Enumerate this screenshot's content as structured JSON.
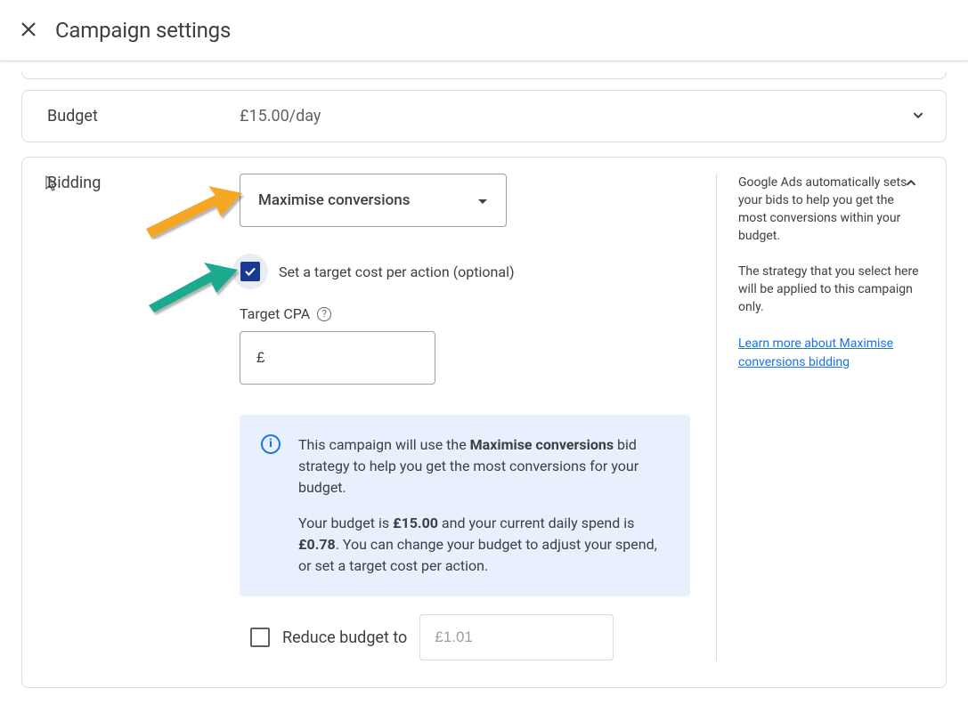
{
  "header": {
    "page_title": "Campaign settings"
  },
  "budget": {
    "label": "Budget",
    "value": "£15.00/day"
  },
  "bidding": {
    "label": "Bidding",
    "dropdown_value": "Maximise conversions",
    "tcpa_checkbox_label": "Set a target cost per action (optional)",
    "tcpa_label": "Target CPA",
    "tcpa_input_value": "£",
    "reduce_label": "Reduce budget to",
    "reduce_placeholder": "£1.01"
  },
  "info": {
    "line1_pre": "This campaign will use the ",
    "line1_bold": "Maximise conversions",
    "line1_post": " bid strategy to help you get the most conversions for your budget.",
    "line2_pre": "Your budget is ",
    "line2_b1": "£15.00",
    "line2_mid": " and your current daily spend is ",
    "line2_b2": "£0.78",
    "line2_post": ". You can change your budget to adjust your spend, or set a target cost per action."
  },
  "help": {
    "p1": "Google Ads automatically sets your bids to help you get the most conversions within your budget.",
    "p2": "The strategy that you select here will be applied to this campaign only.",
    "link": "Learn more about Maximise conversions bidding"
  }
}
